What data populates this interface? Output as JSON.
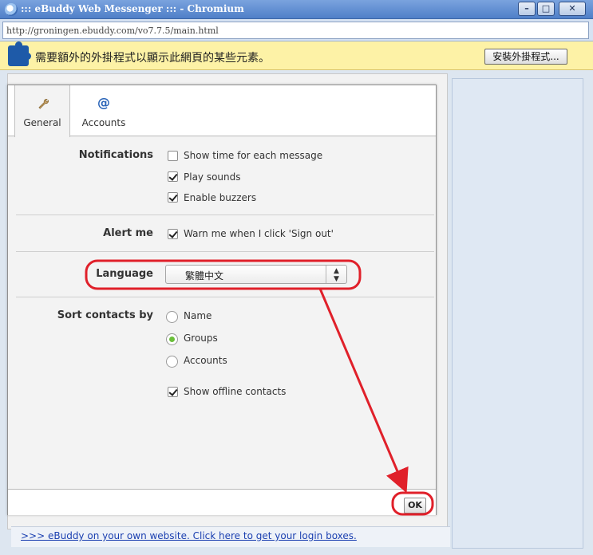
{
  "window": {
    "title": "::: eBuddy Web Messenger ::: - Chromium",
    "minimize": "–",
    "maximize": "□",
    "close": "✕"
  },
  "address_bar": {
    "url": "http://groningen.ebuddy.com/vo7.7.5/main.html"
  },
  "infobar": {
    "message": "需要額外的外掛程式以顯示此網頁的某些元素。",
    "install_button": "安裝外掛程式..."
  },
  "dialog": {
    "tabs": [
      {
        "label": "General",
        "icon": "wrench-icon",
        "active": true
      },
      {
        "label": "Accounts",
        "icon": "at-icon",
        "active": false
      }
    ],
    "notifications": {
      "label": "Notifications",
      "options": [
        {
          "label": "Show time for each message",
          "checked": false
        },
        {
          "label": "Play sounds",
          "checked": true
        },
        {
          "label": "Enable buzzers",
          "checked": true
        }
      ]
    },
    "alert_me": {
      "label": "Alert me",
      "option": {
        "label": "Warn me when I click 'Sign out'",
        "checked": true
      }
    },
    "language": {
      "label": "Language",
      "selected": "繁體中文"
    },
    "sort_contacts": {
      "label": "Sort contacts by",
      "options": [
        {
          "label": "Name",
          "selected": false
        },
        {
          "label": "Groups",
          "selected": true
        },
        {
          "label": "Accounts",
          "selected": false
        }
      ],
      "show_offline": {
        "label": "Show offline contacts",
        "checked": true
      }
    },
    "ok_button": "OK"
  },
  "footer": {
    "link": ">>> eBuddy on your own website. Click here to get your login boxes."
  },
  "colors": {
    "annotation_red": "#e0202a",
    "radio_green": "#6abf3a",
    "infobar_yellow": "#fdf2a6"
  }
}
